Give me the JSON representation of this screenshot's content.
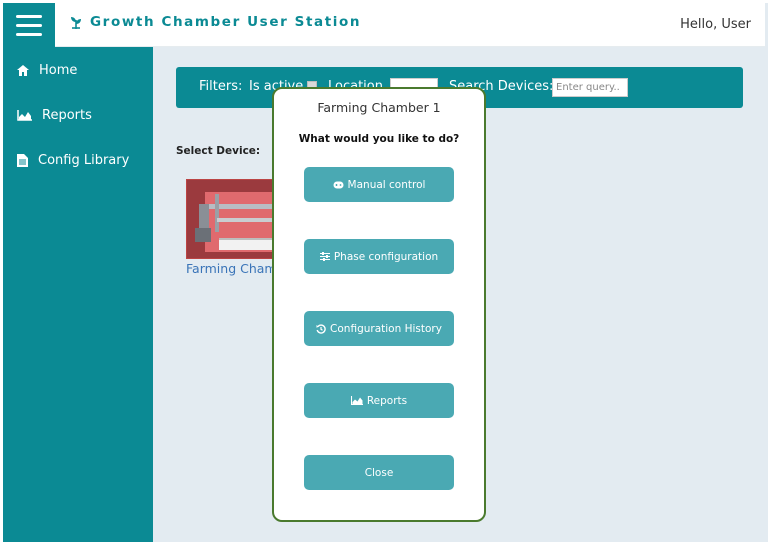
{
  "header": {
    "app_title": "Growth Chamber User Station",
    "greeting": "Hello, User",
    "accent_color": "#0b8a94"
  },
  "sidebar": {
    "items": [
      {
        "label": "Home",
        "icon": "home-icon"
      },
      {
        "label": "Reports",
        "icon": "area-chart-icon"
      },
      {
        "label": "Config Library",
        "icon": "document-icon"
      }
    ]
  },
  "filters": {
    "label": "Filters:",
    "is_active_label": "Is active",
    "location_label": "Location",
    "location_value": "",
    "search_label": "Search Devices:",
    "search_placeholder": "Enter query.."
  },
  "main": {
    "select_device_label": "Select Device:",
    "device": {
      "name": "Farming Chamber 1"
    }
  },
  "modal": {
    "title": "Farming Chamber 1",
    "question": "What would you like to do?",
    "buttons": [
      {
        "label": "Manual control",
        "icon": "gamepad-icon"
      },
      {
        "label": "Phase configuration",
        "icon": "sliders-icon"
      },
      {
        "label": "Configuration History",
        "icon": "history-icon"
      },
      {
        "label": "Reports",
        "icon": "area-chart-icon"
      },
      {
        "label": "Close",
        "icon": ""
      }
    ],
    "border_color": "#4a7a2e",
    "button_color": "#4aa9b3"
  }
}
